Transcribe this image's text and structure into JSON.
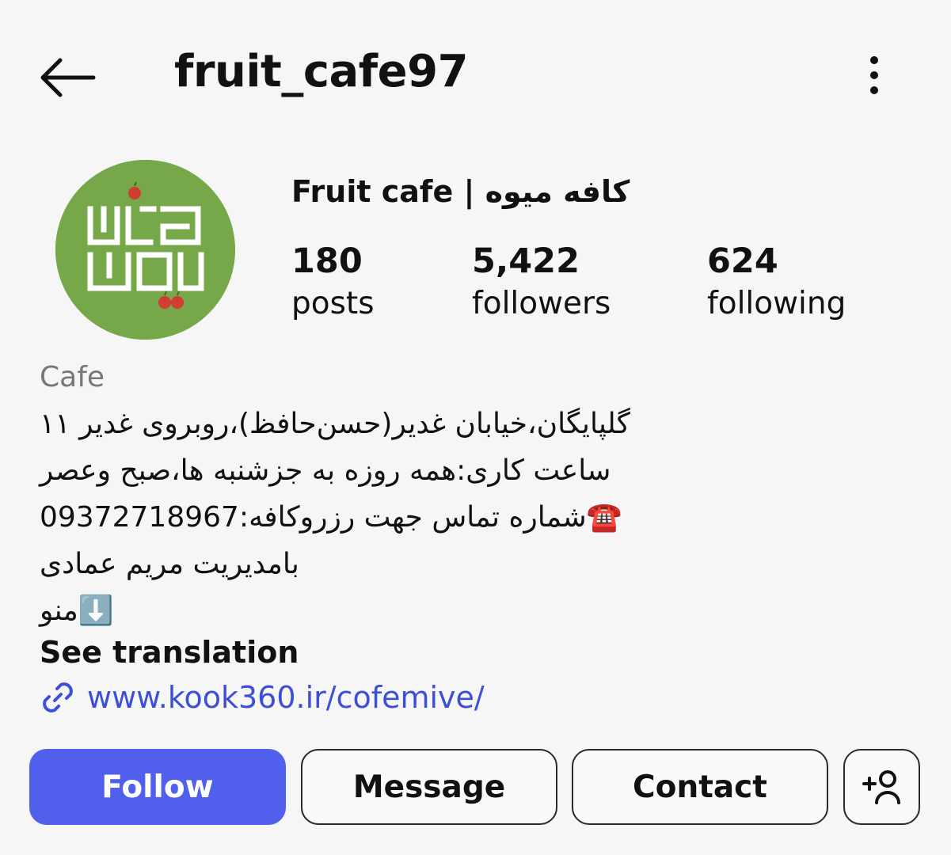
{
  "header": {
    "username": "fruit_cafe97"
  },
  "profile": {
    "avatar_logo_text": "کافه میوه",
    "display_name": "Fruit cafe | کافه میوه",
    "stats": [
      {
        "value": "180",
        "label": "posts"
      },
      {
        "value": "5,422",
        "label": "followers"
      },
      {
        "value": "624",
        "label": "following"
      }
    ],
    "category": "Cafe",
    "bio_lines": [
      "گلپایگان،خیابان غدیر(حسن‌حافظ)،روبروی غدیر ۱۱",
      "ساعت کاری:همه روزه به جزشنبه ها،صبح وعصر",
      "☎️شماره تماس جهت رزروکافه:09372718967",
      "بامدیریت مریم عمادی",
      "⬇️منو"
    ],
    "see_translation": "See translation",
    "link": "www.kook360.ir/cofemive/"
  },
  "actions": {
    "follow": "Follow",
    "message": "Message",
    "contact": "Contact"
  },
  "icons": {
    "back": "arrow-left-icon",
    "more": "more-vertical-icon",
    "link": "link-icon",
    "add_user": "add-user-icon"
  },
  "colors": {
    "background": "#f6f6f6",
    "follow_button": "#5160ec",
    "link": "#3d4fd6",
    "avatar_green": "#76a84a",
    "apple_red": "#d23b2f"
  }
}
